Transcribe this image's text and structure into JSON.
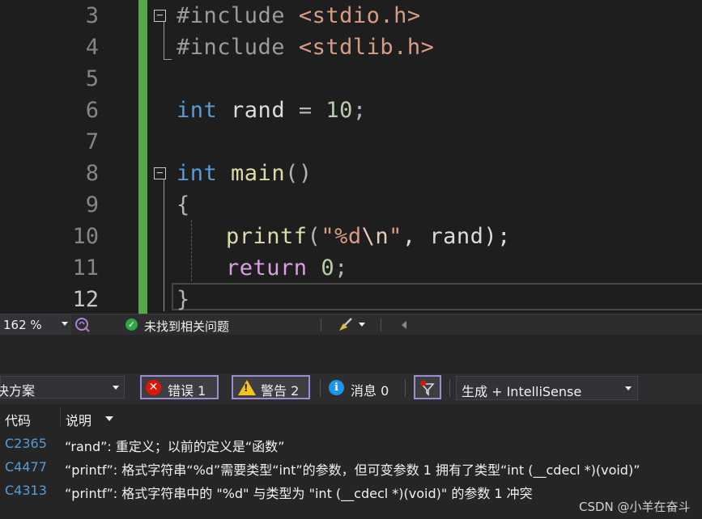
{
  "editor": {
    "line_numbers": [
      "3",
      "4",
      "5",
      "6",
      "7",
      "8",
      "9",
      "10",
      "11",
      "12"
    ],
    "code": {
      "l3": {
        "directive": "#include",
        "header": "<stdio.h>"
      },
      "l4": {
        "directive": "#include",
        "header": "<stdlib.h>"
      },
      "l6": {
        "type": "int",
        "name": "rand",
        "eq": "=",
        "value": "10",
        "semi": ";"
      },
      "l8": {
        "type": "int",
        "name": "main",
        "parens": "()"
      },
      "l9": {
        "brace": "{"
      },
      "l10": {
        "fn": "printf",
        "open": "(",
        "str_open": "\"%d",
        "esc": "\\n",
        "str_close": "\"",
        "rest": ", rand);"
      },
      "l11": {
        "kw": "return",
        "value": "0",
        "semi": ";"
      },
      "l12": {
        "brace": "}"
      }
    },
    "fold_symbol": "−"
  },
  "status_bar": {
    "zoom": "162 %",
    "ok_icon": "check-circle-icon",
    "issues_text": "未找到相关问题"
  },
  "error_list": {
    "scope": "决方案",
    "errors_label": "错误 1",
    "warnings_label": "警告 2",
    "messages_label": "消息 0",
    "build_filter": "生成 + IntelliSense",
    "columns": {
      "code": "代码",
      "description": "说明"
    },
    "rows": [
      {
        "code": "C2365",
        "description": "“rand”: 重定义；以前的定义是“函数”"
      },
      {
        "code": "C4477",
        "description": "“printf”: 格式字符串“%d”需要类型“int”的参数，但可变参数 1 拥有了类型“int (__cdecl *)(void)”"
      },
      {
        "code": "C4313",
        "description": "“printf”: 格式字符串中的 \"%d\" 与类型为 \"int (__cdecl *)(void)\" 的参数 1 冲突"
      }
    ]
  },
  "watermark": "CSDN @小羊在奋斗",
  "colors": {
    "keyword": "#569cd6",
    "control": "#d8a0df",
    "string": "#d69d85",
    "number": "#b5cea8",
    "function": "#dcdcaa",
    "change_bar": "#57a64a",
    "error": "#e51400",
    "warning": "#f5c518",
    "info": "#1c97ea"
  }
}
